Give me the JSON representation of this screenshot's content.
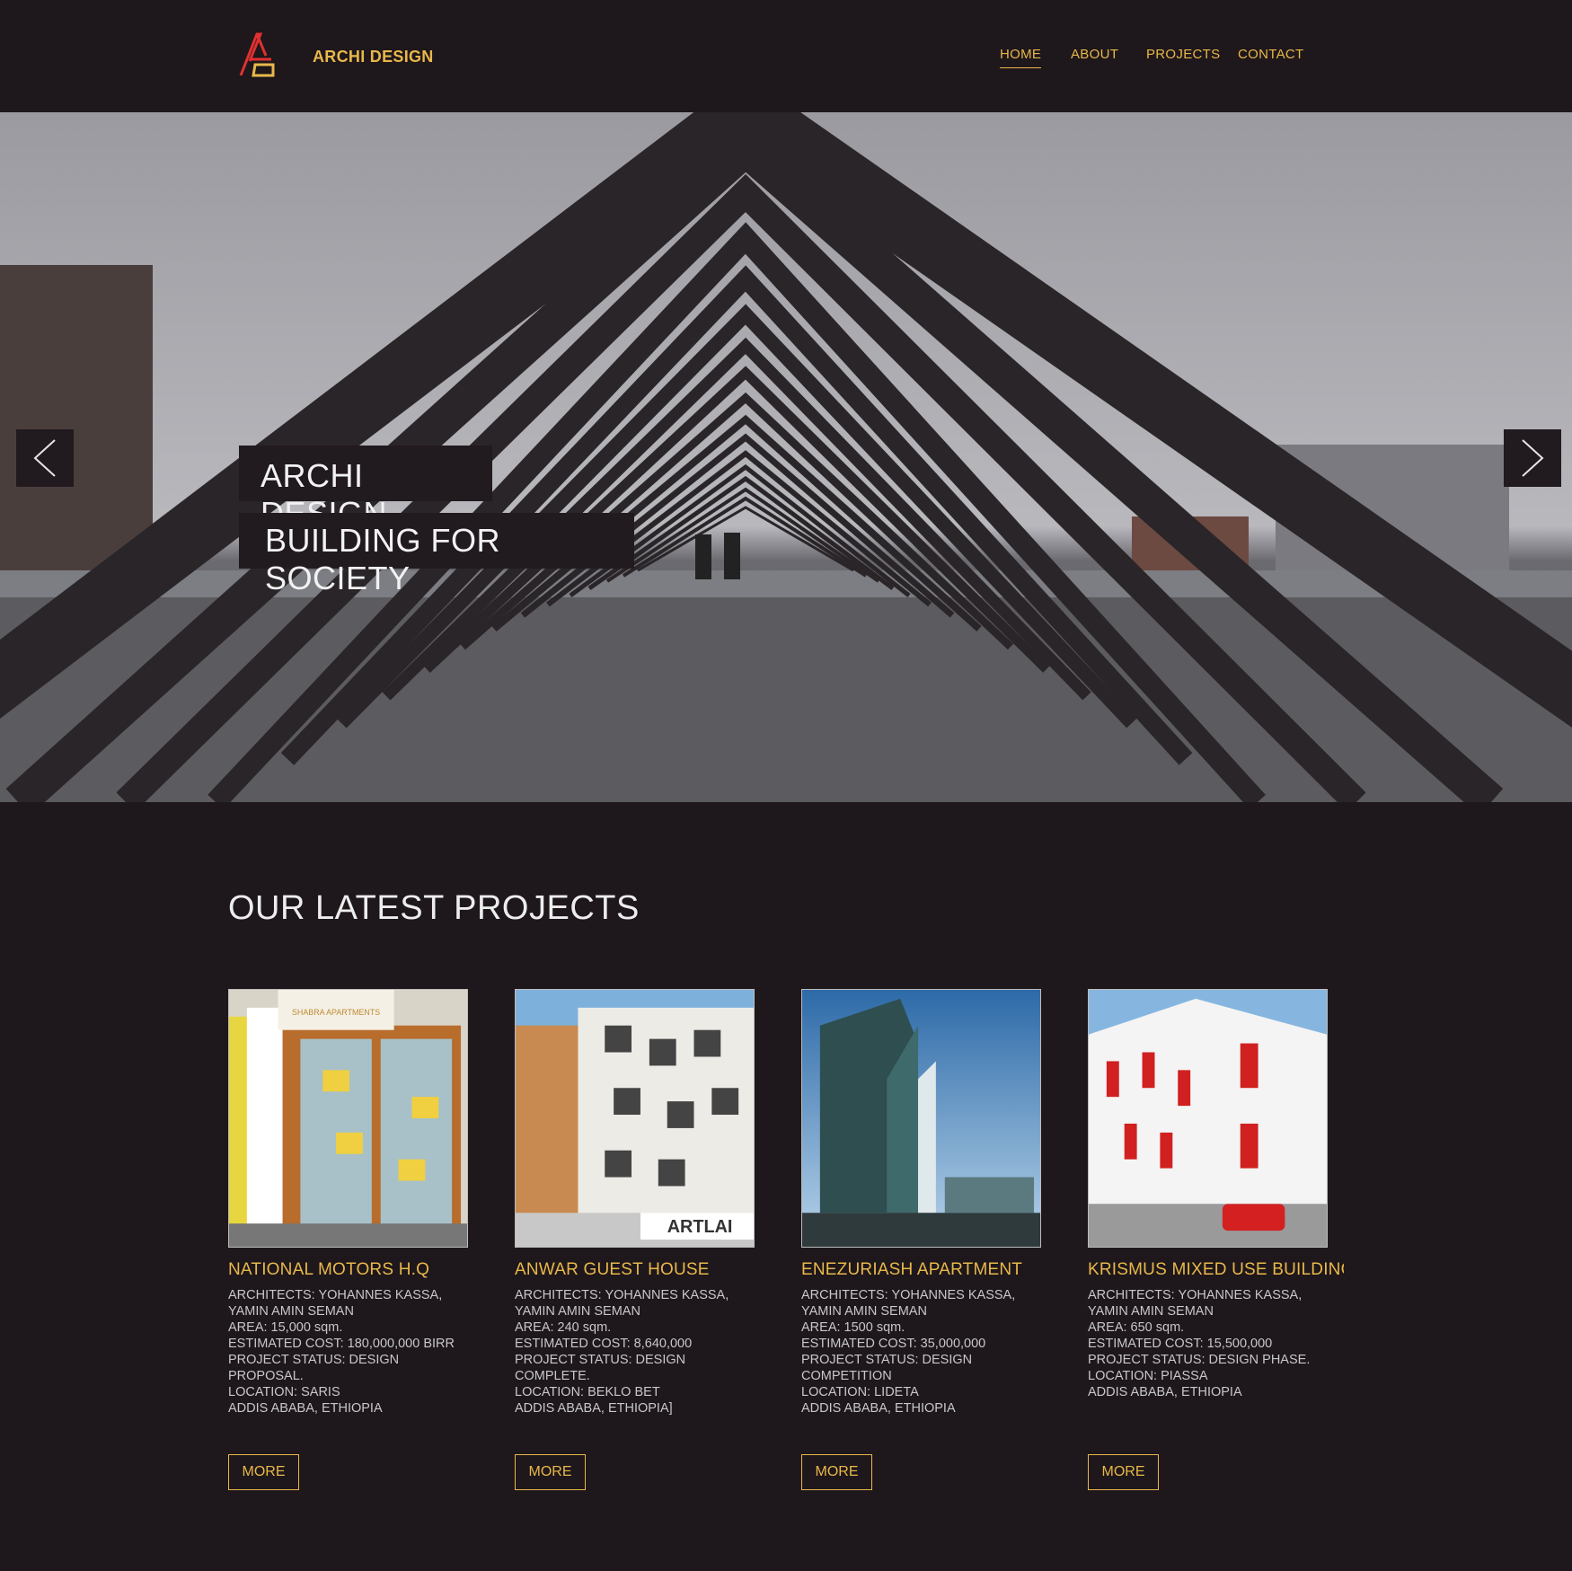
{
  "header": {
    "brand": "ARCHI DESIGN",
    "nav": [
      "HOME",
      "ABOUT",
      "PROJECTS",
      "CONTACT"
    ],
    "active_nav": "HOME"
  },
  "hero": {
    "line1": "ARCHI DESIGN",
    "line2": "BUILDING FOR SOCIETY"
  },
  "projects": {
    "heading": "OUR LATEST PROJECTS",
    "more_label": "MORE",
    "items": [
      {
        "title": "NATIONAL MOTORS H.Q",
        "lines": [
          "ARCHITECTS: YOHANNES KASSA,",
          "YAMIN AMIN SEMAN",
          "AREA: 15,000 sqm.",
          "ESTIMATED COST: 180,000,000 BIRR",
          "PROJECT STATUS: DESIGN",
          "PROPOSAL.",
          "LOCATION: SARIS",
          "ADDIS ABABA, ETHIOPIA"
        ],
        "image_sign": "SHABRA APARTMENTS"
      },
      {
        "title": "ANWAR GUEST HOUSE",
        "lines": [
          "ARCHITECTS: YOHANNES KASSA,",
          "YAMIN AMIN SEMAN",
          "AREA: 240 sqm.",
          "ESTIMATED COST: 8,640,000",
          "PROJECT STATUS: DESIGN",
          "COMPLETE.",
          "LOCATION: BEKLO BET",
          "ADDIS ABABA, ETHIOPIA]"
        ],
        "image_sign": "ARTLAI"
      },
      {
        "title": "ENEZURIASH APARTMENT",
        "lines": [
          "ARCHITECTS: YOHANNES KASSA,",
          "YAMIN AMIN SEMAN",
          "AREA: 1500 sqm.",
          "ESTIMATED COST: 35,000,000",
          "PROJECT STATUS: DESIGN",
          "COMPETITION",
          "LOCATION: LIDETA",
          "ADDIS ABABA, ETHIOPIA"
        ]
      },
      {
        "title": "KRISMUS MIXED USE BUILDING",
        "lines": [
          "ARCHITECTS: YOHANNES KASSA,",
          "YAMIN AMIN SEMAN",
          "AREA: 650 sqm.",
          "ESTIMATED COST: 15,500,000",
          "PROJECT STATUS: DESIGN PHASE.",
          "LOCATION: PIASSA",
          "ADDIS ABABA, ETHIOPIA"
        ]
      }
    ]
  },
  "icons": {
    "logo": "ad-logo-icon",
    "prev": "chevron-left-icon",
    "next": "chevron-right-icon"
  },
  "colors": {
    "background": "#1e171b",
    "accent": "#e8b84a",
    "logo_red": "#e03030"
  }
}
